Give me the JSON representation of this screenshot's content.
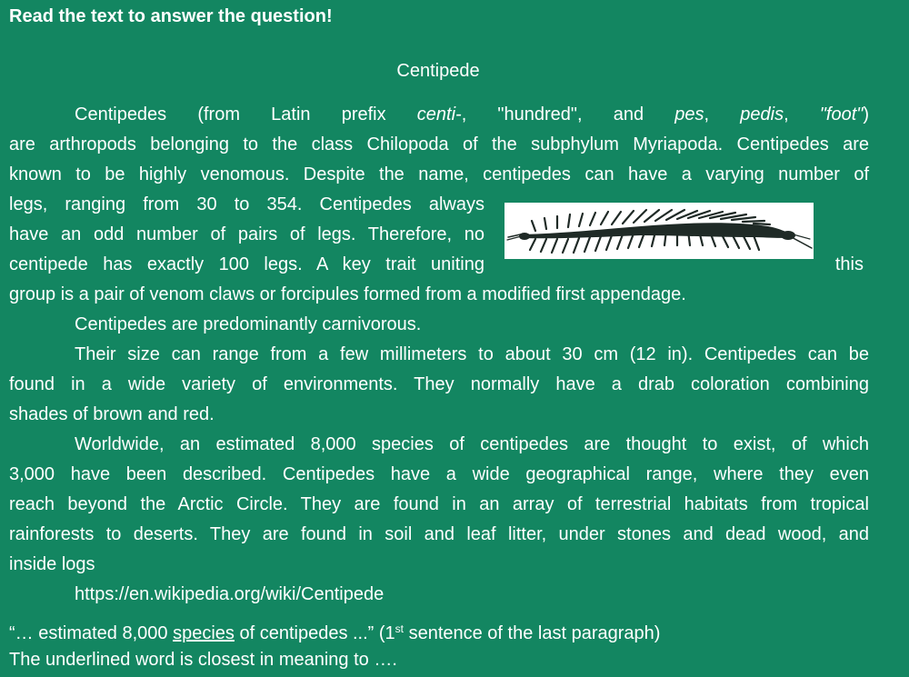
{
  "instruction": "Read the text to answer the question!",
  "title": "Centipede",
  "p1": {
    "l1_a": "Centipedes (from Latin prefix ",
    "l1_i1": "centi-",
    "l1_b": ", \"hundred\", and ",
    "l1_i2": "pes",
    "l1_c": ", ",
    "l1_i3": "pedis",
    "l1_d": ", ",
    "l1_i4": "\"foot\"",
    "l1_e": ")",
    "l2": "are arthropods belonging to the class Chilopoda of the subphylum Myriapoda. Centipedes are",
    "l3": "known to be highly venomous. Despite the name, centipedes can have a varying number of",
    "l4": "legs, ranging from 30 to 354. Centipedes always",
    "l5": "have an odd number of pairs of legs. Therefore, no",
    "l6": "centipede has exactly 100 legs. A key trait uniting",
    "l6_end": "this",
    "l7": "group is a pair of venom claws or forcipules formed from a modified first appendage."
  },
  "p2": "Centipedes are predominantly carnivorous.",
  "p3": {
    "l1": "Their size can range from a few millimeters to about 30 cm (12 in). Centipedes can be",
    "l2": "found in a wide variety of environments. They normally have a drab coloration combining",
    "l3": "shades of brown and red."
  },
  "p4": {
    "l1": "Worldwide, an estimated 8,000 species of centipedes are thought to exist, of which",
    "l2": "3,000 have been described. Centipedes have a wide geographical range, where they even",
    "l3": "reach beyond the Arctic Circle. They are found in an array of terrestrial habitats from tropical",
    "l4": "rainforests to deserts. They are found in soil and leaf litter, under stones and dead wood, and",
    "l5": "inside logs"
  },
  "url": "https://en.wikipedia.org/wiki/Centipede",
  "question": {
    "quote_a": "“… estimated 8,000 ",
    "quote_u": "species",
    "quote_b": " of centipedes ...” (1",
    "quote_sup": "st",
    "quote_c": " sentence of the last paragraph)",
    "line2": "The underlined word is closest in meaning to …."
  },
  "colors": {
    "background": "#138661",
    "text": "#ffffff",
    "centipede": "#1f2a26"
  },
  "figure_icon": "centipede-illustration"
}
